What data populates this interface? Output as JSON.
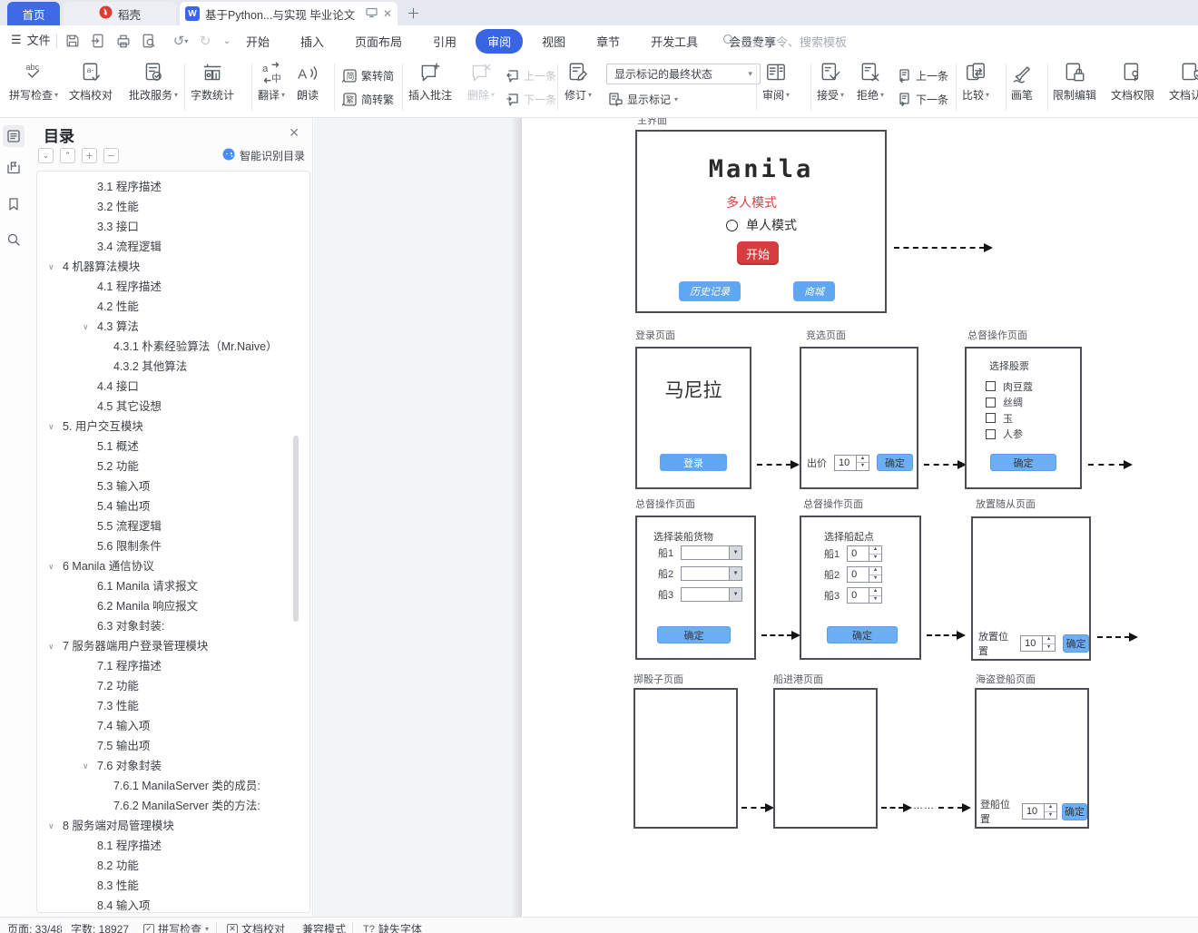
{
  "tab_bar": {
    "home_tab": "首页",
    "docer_tab": "稻壳",
    "document_tab": "基于Python...与实现 毕业论文"
  },
  "menu": {
    "file": "文件",
    "tabs": [
      "开始",
      "插入",
      "页面布局",
      "引用",
      "审阅",
      "视图",
      "章节",
      "开发工具",
      "会员专享"
    ],
    "active_tab": "审阅",
    "search_placeholder": "查找命令、搜索模板"
  },
  "toolbar": {
    "spell": "拼写检查",
    "proof": "文档校对",
    "grade": "批改服务",
    "count": "字数统计",
    "translate": "翻译",
    "read": "朗读",
    "t2s": "繁转简",
    "s2t": "简转繁",
    "insert_comment": "插入批注",
    "del": "删除",
    "prev": "上一条",
    "next": "下一条",
    "revise": "修订",
    "markup_state": "显示标记的最终状态",
    "show_markup": "显示标记",
    "review": "审阅",
    "accept": "接受",
    "reject": "拒绝",
    "prev2": "上一条",
    "next2": "下一条",
    "compare": "比较",
    "pen": "画笔",
    "restrict": "限制编辑",
    "perm": "文档权限",
    "auth": "文档认证"
  },
  "toc": {
    "title": "目录",
    "smart_label": "智能识别目录",
    "items": [
      {
        "t": "3.1 程序描述",
        "level": 2
      },
      {
        "t": "3.2 性能",
        "level": 2
      },
      {
        "t": "3.3 接口",
        "level": 2
      },
      {
        "t": "3.4 流程逻辑",
        "level": 2
      },
      {
        "t": "4 机器算法模块",
        "level": 1,
        "chevron": true
      },
      {
        "t": "4.1 程序描述",
        "level": 2
      },
      {
        "t": "4.2 性能",
        "level": 2
      },
      {
        "t": "4.3 算法",
        "level": 2,
        "chevron": true
      },
      {
        "t": "4.3.1 朴素经验算法（Mr.Naive）",
        "level": 3
      },
      {
        "t": "4.3.2 其他算法",
        "level": 3
      },
      {
        "t": "4.4 接口",
        "level": 2
      },
      {
        "t": "4.5 其它设想",
        "level": 2
      },
      {
        "t": "5. 用户交互模块",
        "level": 1,
        "chevron": true
      },
      {
        "t": "5.1 概述",
        "level": 2
      },
      {
        "t": "5.2 功能",
        "level": 2
      },
      {
        "t": "5.3 输入项",
        "level": 2
      },
      {
        "t": "5.4 输出项",
        "level": 2
      },
      {
        "t": "5.5 流程逻辑",
        "level": 2
      },
      {
        "t": "5.6 限制条件",
        "level": 2
      },
      {
        "t": "6 Manila 通信协议",
        "level": 1,
        "chevron": true
      },
      {
        "t": "6.1 Manila 请求报文",
        "level": 2
      },
      {
        "t": "6.2 Manila 响应报文",
        "level": 2
      },
      {
        "t": "6.3 对象封装:",
        "level": 2
      },
      {
        "t": "7 服务器端用户登录管理模块",
        "level": 1,
        "chevron": true
      },
      {
        "t": "7.1 程序描述",
        "level": 2
      },
      {
        "t": "7.2 功能",
        "level": 2
      },
      {
        "t": "7.3 性能",
        "level": 2
      },
      {
        "t": "7.4 输入项",
        "level": 2
      },
      {
        "t": "7.5 输出项",
        "level": 2
      },
      {
        "t": "7.6 对象封装",
        "level": 2,
        "chevron": true
      },
      {
        "t": "7.6.1 ManilaServer 类的成员:",
        "level": 3
      },
      {
        "t": "7.6.2 ManilaServer 类的方法:",
        "level": 3
      },
      {
        "t": "8 服务端对局管理模块",
        "level": 1,
        "chevron": true
      },
      {
        "t": "8.1 程序描述",
        "level": 2
      },
      {
        "t": "8.2 功能",
        "level": 2
      },
      {
        "t": "8.3 性能",
        "level": 2
      },
      {
        "t": "8.4 输入项",
        "level": 2
      }
    ]
  },
  "page": {
    "main_screen": {
      "label": "主界面",
      "title": "Manila",
      "radio_multi": "多人模式",
      "radio_single": "单人模式",
      "start_btn": "开始",
      "history_btn": "历史记录",
      "shop_btn": "商城"
    },
    "login": {
      "label": "登录页面",
      "title": "马尼拉",
      "login_btn": "登录"
    },
    "bid": {
      "label": "竞选页面",
      "price_label": "出价",
      "price_value": "10",
      "ok_btn": "确定"
    },
    "stock": {
      "label": "总督操作页面",
      "title": "选择股票",
      "options": [
        "肉豆蔻",
        "丝绸",
        "玉",
        "人参"
      ],
      "ok_btn": "确定"
    },
    "cargo": {
      "label": "总督操作页面",
      "title": "选择装船货物",
      "ships": [
        "船1",
        "船2",
        "船3"
      ],
      "ok_btn": "确定"
    },
    "shipstart": {
      "label": "总督操作页面",
      "title": "选择船起点",
      "ships": [
        "船1",
        "船2",
        "船3"
      ],
      "value": "0",
      "ok_btn": "确定"
    },
    "follower": {
      "label": "放置随从页面",
      "pos_label": "放置位置",
      "value": "10",
      "ok_btn": "确定"
    },
    "dice": {
      "label": "掷骰子页面"
    },
    "port": {
      "label": "船进港页面"
    },
    "pirate": {
      "label": "海盗登船页面",
      "pos_label": "登船位置",
      "value": "10",
      "ok_btn": "确定"
    },
    "dots": "……"
  },
  "status_bar": {
    "page_label": "页面: 33/48",
    "word_label": "字数: 18927",
    "spell": "拼写检查",
    "proof": "文档校对",
    "compat": "兼容模式",
    "missing_font": "缺失字体"
  },
  "colors": {
    "accent_blue": "#3866e3",
    "button_blue": "#5fa6f3",
    "button_red": "#d63c40",
    "radio_red_text": "#d94040"
  }
}
